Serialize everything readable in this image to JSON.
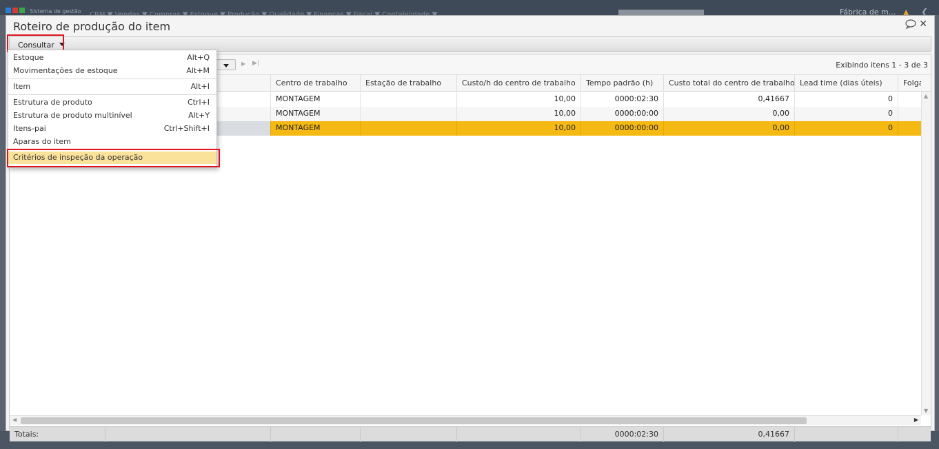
{
  "app": {
    "title": "Sistema de gestão",
    "menu_text": "CRM ▼  Vendas ▼  Compras ▼  Estoque ▼  Produção ▼  Qualidade ▼  Finanças ▼  Fiscal ▼  Contabilidade ▼",
    "company": "Fábrica de m..."
  },
  "dialog": {
    "title": "Roteiro de produção do item"
  },
  "toolbar": {
    "consultar_label": "Consultar"
  },
  "menu": {
    "items": [
      {
        "label": "Estoque",
        "shortcut": "Alt+Q"
      },
      {
        "label": "Movimentações de estoque",
        "shortcut": "Alt+M"
      },
      {
        "label": "Item",
        "shortcut": "Alt+I"
      },
      {
        "label": "Estrutura de produto",
        "shortcut": "Ctrl+I"
      },
      {
        "label": "Estrutura de produto multinível",
        "shortcut": "Alt+Y"
      },
      {
        "label": "Itens-pai",
        "shortcut": "Ctrl+Shift+I"
      },
      {
        "label": "Aparas do item",
        "shortcut": ""
      },
      {
        "label": "Critérios de inspeção da operação",
        "shortcut": ""
      }
    ]
  },
  "pager": {
    "info": "Exibindo itens 1 - 3 de 3"
  },
  "grid": {
    "columns": [
      "Centro de trabalho",
      "Estação de trabalho",
      "Custo/h do centro de trabalho",
      "Tempo padrão (h)",
      "Custo total do centro de trabalho",
      "Lead time (dias úteis)",
      "Folga"
    ],
    "rows": [
      {
        "centro": "MONTAGEM",
        "estacao": "",
        "custo_h": "10,00",
        "tempo": "0000:02:30",
        "custo_total": "0,41667",
        "lead_time": "0"
      },
      {
        "centro": "MONTAGEM",
        "estacao": "",
        "custo_h": "10,00",
        "tempo": "0000:00:00",
        "custo_total": "0,00",
        "lead_time": "0"
      },
      {
        "centro": "MONTAGEM",
        "estacao": "",
        "custo_h": "10,00",
        "tempo": "0000:00:00",
        "custo_total": "0,00",
        "lead_time": "0"
      }
    ],
    "selected_row_color": "#f5b914",
    "totals": {
      "label": "Totais:",
      "tempo": "0000:02:30",
      "custo_total": "0,41667"
    }
  },
  "colors": {
    "highlight_border": "#e0141e",
    "menu_active": "#fbe29a"
  }
}
